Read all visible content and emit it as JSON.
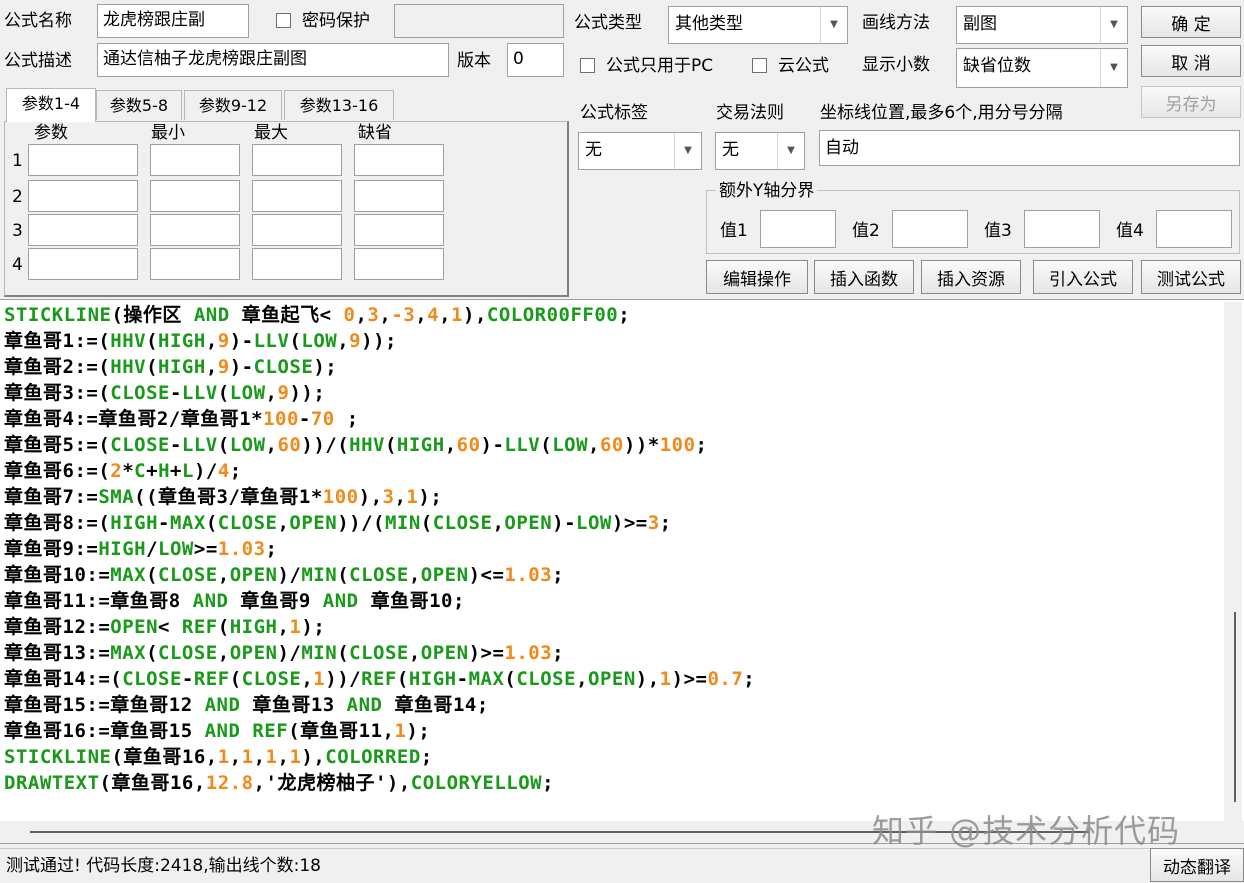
{
  "header": {
    "name_label": "公式名称",
    "name_value": "龙虎榜跟庄副",
    "password_label": "密码保护",
    "password_value": "",
    "desc_label": "公式描述",
    "desc_value": "通达信柚子龙虎榜跟庄副图",
    "version_label": "版本",
    "version_value": "0"
  },
  "right_panel": {
    "type_label": "公式类型",
    "type_value": "其他类型",
    "draw_label": "画线方法",
    "draw_value": "副图",
    "pc_only_label": "公式只用于PC",
    "cloud_label": "云公式",
    "decimals_label": "显示小数",
    "decimals_value": "缺省位数",
    "tag_label": "公式标签",
    "tag_value": "无",
    "rule_label": "交易法则",
    "rule_value": "无",
    "axis_label": "坐标线位置,最多6个,用分号分隔",
    "axis_value": "自动",
    "yaxis_group_label": "额外Y轴分界",
    "yaxis_values": [
      "值1",
      "值2",
      "值3",
      "值4"
    ]
  },
  "buttons": {
    "ok": "确  定",
    "cancel": "取  消",
    "save_as": "另存为",
    "edit_ops": "编辑操作",
    "insert_func": "插入函数",
    "insert_res": "插入资源",
    "import_formula": "引入公式",
    "test_formula": "测试公式",
    "dynamic_translate": "动态翻译"
  },
  "params": {
    "tabs": [
      "参数1-4",
      "参数5-8",
      "参数9-12",
      "参数13-16"
    ],
    "columns": [
      "参数",
      "最小",
      "最大",
      "缺省"
    ],
    "rows": [
      "1",
      "2",
      "3",
      "4"
    ]
  },
  "code_lines": [
    [
      [
        "fn",
        "STICKLINE"
      ],
      [
        "t",
        "(操作区 "
      ],
      [
        "fn",
        "AND"
      ],
      [
        "t",
        " 章鱼起飞< "
      ],
      [
        "n",
        "0"
      ],
      [
        "t",
        ","
      ],
      [
        "n",
        "3"
      ],
      [
        "t",
        ","
      ],
      [
        "n",
        "-3"
      ],
      [
        "t",
        ","
      ],
      [
        "n",
        "4"
      ],
      [
        "t",
        ","
      ],
      [
        "n",
        "1"
      ],
      [
        "t",
        "),"
      ],
      [
        "c",
        "COLOR00FF00"
      ],
      [
        "t",
        ";"
      ]
    ],
    [
      [
        "t",
        "章鱼哥1:=("
      ],
      [
        "fn",
        "HHV"
      ],
      [
        "t",
        "("
      ],
      [
        "fn",
        "HIGH"
      ],
      [
        "t",
        ","
      ],
      [
        "n",
        "9"
      ],
      [
        "t",
        ")-"
      ],
      [
        "fn",
        "LLV"
      ],
      [
        "t",
        "("
      ],
      [
        "fn",
        "LOW"
      ],
      [
        "t",
        ","
      ],
      [
        "n",
        "9"
      ],
      [
        "t",
        "));"
      ]
    ],
    [
      [
        "t",
        "章鱼哥2:=("
      ],
      [
        "fn",
        "HHV"
      ],
      [
        "t",
        "("
      ],
      [
        "fn",
        "HIGH"
      ],
      [
        "t",
        ","
      ],
      [
        "n",
        "9"
      ],
      [
        "t",
        ")-"
      ],
      [
        "fn",
        "CLOSE"
      ],
      [
        "t",
        ");"
      ]
    ],
    [
      [
        "t",
        "章鱼哥3:=("
      ],
      [
        "fn",
        "CLOSE"
      ],
      [
        "t",
        "-"
      ],
      [
        "fn",
        "LLV"
      ],
      [
        "t",
        "("
      ],
      [
        "fn",
        "LOW"
      ],
      [
        "t",
        ","
      ],
      [
        "n",
        "9"
      ],
      [
        "t",
        "));"
      ]
    ],
    [
      [
        "t",
        "章鱼哥4:=章鱼哥2/章鱼哥1*"
      ],
      [
        "n",
        "100"
      ],
      [
        "t",
        "-"
      ],
      [
        "n",
        "70"
      ],
      [
        "t",
        " ;"
      ]
    ],
    [
      [
        "t",
        "章鱼哥5:=("
      ],
      [
        "fn",
        "CLOSE"
      ],
      [
        "t",
        "-"
      ],
      [
        "fn",
        "LLV"
      ],
      [
        "t",
        "("
      ],
      [
        "fn",
        "LOW"
      ],
      [
        "t",
        ","
      ],
      [
        "n",
        "60"
      ],
      [
        "t",
        "))/("
      ],
      [
        "fn",
        "HHV"
      ],
      [
        "t",
        "("
      ],
      [
        "fn",
        "HIGH"
      ],
      [
        "t",
        ","
      ],
      [
        "n",
        "60"
      ],
      [
        "t",
        ")-"
      ],
      [
        "fn",
        "LLV"
      ],
      [
        "t",
        "("
      ],
      [
        "fn",
        "LOW"
      ],
      [
        "t",
        ","
      ],
      [
        "n",
        "60"
      ],
      [
        "t",
        "))*"
      ],
      [
        "n",
        "100"
      ],
      [
        "t",
        ";"
      ]
    ],
    [
      [
        "t",
        "章鱼哥6:=("
      ],
      [
        "n",
        "2"
      ],
      [
        "t",
        "*"
      ],
      [
        "fn",
        "C"
      ],
      [
        "t",
        "+"
      ],
      [
        "fn",
        "H"
      ],
      [
        "t",
        "+"
      ],
      [
        "fn",
        "L"
      ],
      [
        "t",
        ")/"
      ],
      [
        "n",
        "4"
      ],
      [
        "t",
        ";"
      ]
    ],
    [
      [
        "t",
        "章鱼哥7:="
      ],
      [
        "fn",
        "SMA"
      ],
      [
        "t",
        "((章鱼哥3/章鱼哥1*"
      ],
      [
        "n",
        "100"
      ],
      [
        "t",
        "),"
      ],
      [
        "n",
        "3"
      ],
      [
        "t",
        ","
      ],
      [
        "n",
        "1"
      ],
      [
        "t",
        ");"
      ]
    ],
    [
      [
        "t",
        "章鱼哥8:=("
      ],
      [
        "fn",
        "HIGH"
      ],
      [
        "t",
        "-"
      ],
      [
        "fn",
        "MAX"
      ],
      [
        "t",
        "("
      ],
      [
        "fn",
        "CLOSE"
      ],
      [
        "t",
        ","
      ],
      [
        "fn",
        "OPEN"
      ],
      [
        "t",
        "))/("
      ],
      [
        "fn",
        "MIN"
      ],
      [
        "t",
        "("
      ],
      [
        "fn",
        "CLOSE"
      ],
      [
        "t",
        ","
      ],
      [
        "fn",
        "OPEN"
      ],
      [
        "t",
        ")-"
      ],
      [
        "fn",
        "LOW"
      ],
      [
        "t",
        ")>="
      ],
      [
        "n",
        "3"
      ],
      [
        "t",
        ";"
      ]
    ],
    [
      [
        "t",
        "章鱼哥9:="
      ],
      [
        "fn",
        "HIGH"
      ],
      [
        "t",
        "/"
      ],
      [
        "fn",
        "LOW"
      ],
      [
        "t",
        ">="
      ],
      [
        "n",
        "1.03"
      ],
      [
        "t",
        ";"
      ]
    ],
    [
      [
        "t",
        "章鱼哥10:="
      ],
      [
        "fn",
        "MAX"
      ],
      [
        "t",
        "("
      ],
      [
        "fn",
        "CLOSE"
      ],
      [
        "t",
        ","
      ],
      [
        "fn",
        "OPEN"
      ],
      [
        "t",
        ")/"
      ],
      [
        "fn",
        "MIN"
      ],
      [
        "t",
        "("
      ],
      [
        "fn",
        "CLOSE"
      ],
      [
        "t",
        ","
      ],
      [
        "fn",
        "OPEN"
      ],
      [
        "t",
        ")<="
      ],
      [
        "n",
        "1.03"
      ],
      [
        "t",
        ";"
      ]
    ],
    [
      [
        "t",
        "章鱼哥11:=章鱼哥8 "
      ],
      [
        "fn",
        "AND"
      ],
      [
        "t",
        " 章鱼哥9 "
      ],
      [
        "fn",
        "AND"
      ],
      [
        "t",
        " 章鱼哥10;"
      ]
    ],
    [
      [
        "t",
        "章鱼哥12:="
      ],
      [
        "fn",
        "OPEN"
      ],
      [
        "t",
        "< "
      ],
      [
        "fn",
        "REF"
      ],
      [
        "t",
        "("
      ],
      [
        "fn",
        "HIGH"
      ],
      [
        "t",
        ","
      ],
      [
        "n",
        "1"
      ],
      [
        "t",
        ");"
      ]
    ],
    [
      [
        "t",
        "章鱼哥13:="
      ],
      [
        "fn",
        "MAX"
      ],
      [
        "t",
        "("
      ],
      [
        "fn",
        "CLOSE"
      ],
      [
        "t",
        ","
      ],
      [
        "fn",
        "OPEN"
      ],
      [
        "t",
        ")/"
      ],
      [
        "fn",
        "MIN"
      ],
      [
        "t",
        "("
      ],
      [
        "fn",
        "CLOSE"
      ],
      [
        "t",
        ","
      ],
      [
        "fn",
        "OPEN"
      ],
      [
        "t",
        ")>="
      ],
      [
        "n",
        "1.03"
      ],
      [
        "t",
        ";"
      ]
    ],
    [
      [
        "t",
        "章鱼哥14:=("
      ],
      [
        "fn",
        "CLOSE"
      ],
      [
        "t",
        "-"
      ],
      [
        "fn",
        "REF"
      ],
      [
        "t",
        "("
      ],
      [
        "fn",
        "CLOSE"
      ],
      [
        "t",
        ","
      ],
      [
        "n",
        "1"
      ],
      [
        "t",
        "))/"
      ],
      [
        "fn",
        "REF"
      ],
      [
        "t",
        "("
      ],
      [
        "fn",
        "HIGH"
      ],
      [
        "t",
        "-"
      ],
      [
        "fn",
        "MAX"
      ],
      [
        "t",
        "("
      ],
      [
        "fn",
        "CLOSE"
      ],
      [
        "t",
        ","
      ],
      [
        "fn",
        "OPEN"
      ],
      [
        "t",
        "),"
      ],
      [
        "n",
        "1"
      ],
      [
        "t",
        ")>="
      ],
      [
        "n",
        "0.7"
      ],
      [
        "t",
        ";"
      ]
    ],
    [
      [
        "t",
        "章鱼哥15:=章鱼哥12 "
      ],
      [
        "fn",
        "AND"
      ],
      [
        "t",
        " 章鱼哥13 "
      ],
      [
        "fn",
        "AND"
      ],
      [
        "t",
        " 章鱼哥14;"
      ]
    ],
    [
      [
        "t",
        "章鱼哥16:=章鱼哥15 "
      ],
      [
        "fn",
        "AND"
      ],
      [
        "t",
        " "
      ],
      [
        "fn",
        "REF"
      ],
      [
        "t",
        "(章鱼哥11,"
      ],
      [
        "n",
        "1"
      ],
      [
        "t",
        ");"
      ]
    ],
    [
      [
        "fn",
        "STICKLINE"
      ],
      [
        "t",
        "(章鱼哥16,"
      ],
      [
        "n",
        "1"
      ],
      [
        "t",
        ","
      ],
      [
        "n",
        "1"
      ],
      [
        "t",
        ","
      ],
      [
        "n",
        "1"
      ],
      [
        "t",
        ","
      ],
      [
        "n",
        "1"
      ],
      [
        "t",
        "),"
      ],
      [
        "c",
        "COLORRED"
      ],
      [
        "t",
        ";"
      ]
    ],
    [
      [
        "fn",
        "DRAWTEXT"
      ],
      [
        "t",
        "(章鱼哥16,"
      ],
      [
        "n",
        "12.8"
      ],
      [
        "t",
        ","
      ],
      [
        "s",
        "'龙虎榜柚子'"
      ],
      [
        "t",
        "),"
      ],
      [
        "c",
        "COLORYELLOW"
      ],
      [
        "t",
        ";"
      ]
    ]
  ],
  "status": "测试通过! 代码长度:2418,输出线个数:18",
  "watermark": "知乎 @技术分析代码",
  "colors": {
    "function": "#1a9a1a",
    "number": "#f28a1a",
    "text": "#000000"
  }
}
